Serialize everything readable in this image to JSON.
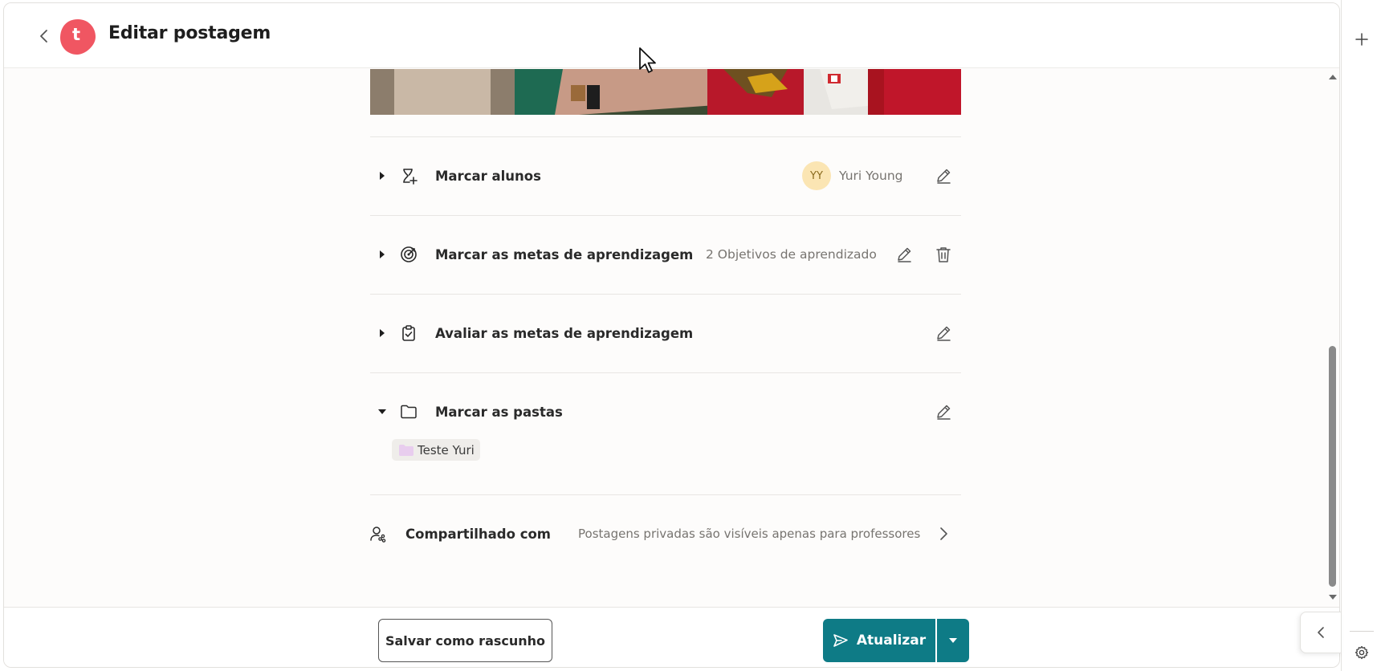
{
  "header": {
    "title": "Editar postagem",
    "logo_letter": "t"
  },
  "sections": {
    "students": {
      "title": "Marcar alunos",
      "avatar_initials": "YY",
      "student_name": "Yuri Young"
    },
    "goals": {
      "title": "Marcar as metas de aprendizagem",
      "summary": "2 Objetivos de aprendizado"
    },
    "assess": {
      "title": "Avaliar as metas de aprendizagem"
    },
    "folders": {
      "title": "Marcar as pastas",
      "tags": [
        "Teste Yuri"
      ]
    },
    "shared": {
      "title": "Compartilhado com",
      "description": "Postagens privadas são visíveis apenas para professores"
    }
  },
  "footer": {
    "save_draft_label": "Salvar como rascunho",
    "update_label": "Atualizar"
  },
  "colors": {
    "accent": "#0e7b86",
    "logo": "#f05662",
    "avatar_bg": "#fbe5b3",
    "folder_icon": "#e8cdee"
  },
  "icons": {
    "back": "chevron-left-icon",
    "students": "user-plus-icon",
    "goals": "target-icon",
    "assess": "clipboard-check-icon",
    "folders": "folder-icon",
    "shared": "user-share-icon",
    "edit": "pencil-icon",
    "delete": "trash-icon",
    "send": "send-icon",
    "add": "plus-icon",
    "settings": "gear-icon"
  }
}
